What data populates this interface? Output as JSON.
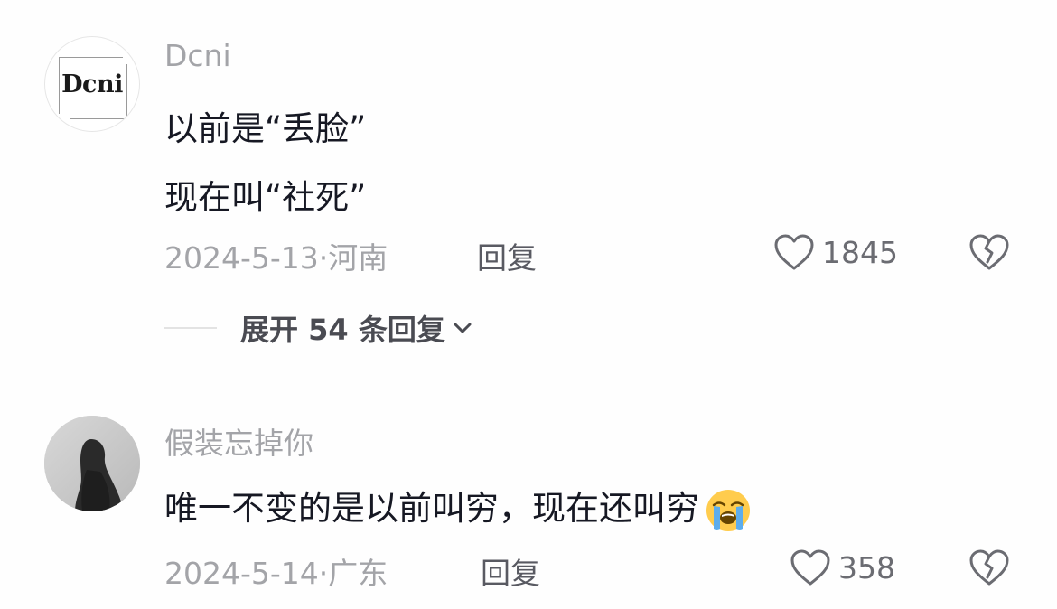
{
  "comments": [
    {
      "username": "Dcni",
      "avatar_text": "Dcni",
      "lines": [
        "以前是“丢脸”",
        "现在叫“社死”"
      ],
      "date": "2024-5-13",
      "location": "河南",
      "reply_label": "回复",
      "likes": "1845",
      "expand_label": "展开 54 条回复"
    },
    {
      "username": "假装忘掉你",
      "lines": [
        "唯一不变的是以前叫穷，现在还叫穷"
      ],
      "emoji": "loudly-crying-face",
      "date": "2024-5-14",
      "location": "广东",
      "reply_label": "回复",
      "likes": "358"
    }
  ],
  "colors": {
    "primary_text": "#161823",
    "secondary_text": "#a3a4a8",
    "reply_text": "#595a62",
    "background": "#fefefe"
  }
}
